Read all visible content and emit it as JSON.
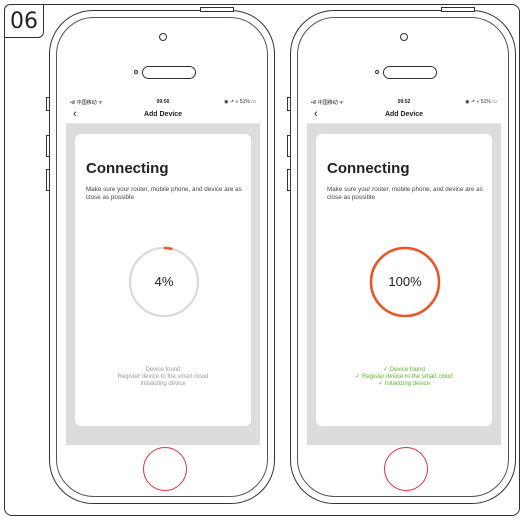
{
  "step_label": "06",
  "phones": [
    {
      "status": {
        "carrier": "•ıll 中国移动 ᯤ",
        "time": "09:50",
        "right": "◉ ⬏ ◗ 51% ▭"
      },
      "nav": {
        "back": "‹",
        "title": "Add Device"
      },
      "heading": "Connecting",
      "hint": "Make sure your router, mobile phone, and device are as close as possible",
      "progress": {
        "label": "4%",
        "value": 0.04
      },
      "steps": [
        "Device found",
        "Register device to the smart cloud",
        "Initializing device"
      ],
      "steps_done": false
    },
    {
      "status": {
        "carrier": "•ıll 中国移动 ᯤ",
        "time": "09:52",
        "right": "◉ ⬏ ◗ 51% ▭"
      },
      "nav": {
        "back": "‹",
        "title": "Add Device"
      },
      "heading": "Connecting",
      "hint": "Make sure your router, mobile phone, and device are as close as possible",
      "progress": {
        "label": "100%",
        "value": 1.0
      },
      "steps": [
        "✓ Device found",
        "✓ Register device to the smart cloud",
        "✓ Initializing device"
      ],
      "steps_done": true
    }
  ],
  "colors": {
    "progress": "#e8572a",
    "track": "#dadada",
    "done": "#5cb531",
    "pending": "#9a9a9a"
  }
}
